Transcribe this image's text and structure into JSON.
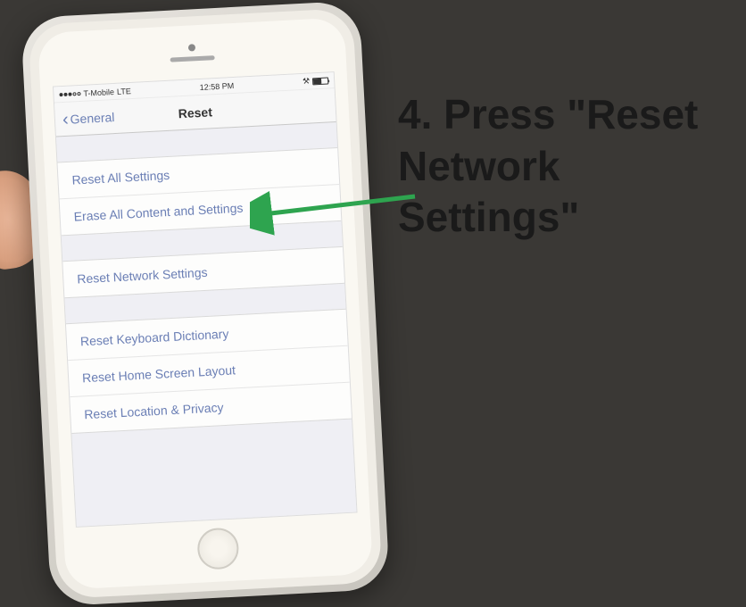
{
  "instruction": {
    "text": "4. Press \"Reset Network Settings\""
  },
  "statusBar": {
    "carrier": "T-Mobile",
    "network": "LTE",
    "time": "12:58 PM"
  },
  "navBar": {
    "back": "General",
    "title": "Reset"
  },
  "groups": [
    {
      "items": [
        {
          "label": "Reset All Settings"
        },
        {
          "label": "Erase All Content and Settings"
        }
      ]
    },
    {
      "items": [
        {
          "label": "Reset Network Settings"
        }
      ]
    },
    {
      "items": [
        {
          "label": "Reset Keyboard Dictionary"
        },
        {
          "label": "Reset Home Screen Layout"
        },
        {
          "label": "Reset Location & Privacy"
        }
      ]
    }
  ],
  "arrow": {
    "color": "#2ea44f"
  }
}
